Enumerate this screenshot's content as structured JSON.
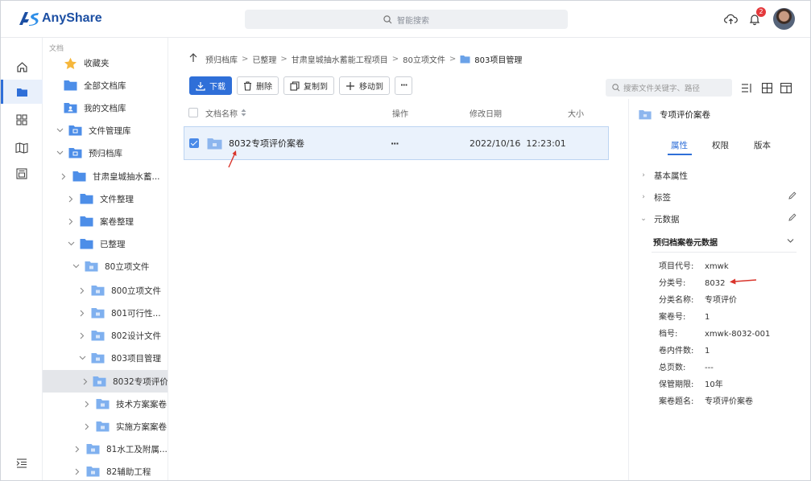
{
  "app": {
    "name": "AnyShare"
  },
  "header": {
    "search_placeholder": "智能搜索",
    "notification_count": "2",
    "colors": {
      "brand": "#1c4fa3",
      "accent": "#2f6fd8",
      "badge": "#e4393c"
    }
  },
  "rail": {
    "items": [
      "home-icon",
      "folder-icon",
      "apps-grid-icon",
      "book-icon",
      "contact-card-icon"
    ],
    "bottom": "collapse-menu-icon"
  },
  "tree": {
    "heading": "文档",
    "items": [
      {
        "label": "收藏夹",
        "icon": "star-icon"
      },
      {
        "label": "全部文档库",
        "icon": "folder-icon"
      },
      {
        "label": "我的文档库",
        "icon": "user-folder-icon"
      },
      {
        "label": "文件管理库",
        "icon": "library-icon",
        "state": "expanded"
      },
      {
        "label": "预归档库",
        "icon": "library-icon",
        "state": "expanded"
      },
      {
        "label": "甘肃皇城抽水蓄...",
        "icon": "folder-icon",
        "state": "collapsed"
      },
      {
        "label": "文件整理",
        "icon": "folder-icon",
        "state": "collapsed"
      },
      {
        "label": "案卷整理",
        "icon": "folder-icon",
        "state": "collapsed"
      },
      {
        "label": "已整理",
        "icon": "folder-icon",
        "state": "expanded"
      },
      {
        "label": "80立项文件",
        "icon": "archive-folder-icon",
        "state": "expanded"
      },
      {
        "label": "800立项文件",
        "icon": "archive-folder-icon",
        "state": "collapsed"
      },
      {
        "label": "801可行性...",
        "icon": "archive-folder-icon",
        "state": "collapsed"
      },
      {
        "label": "802设计文件",
        "icon": "archive-folder-icon",
        "state": "collapsed"
      },
      {
        "label": "803项目管理",
        "icon": "archive-folder-icon",
        "state": "expanded"
      },
      {
        "label": "8032专项评价案",
        "icon": "archive-folder-icon",
        "state": "collapsed",
        "selected": true
      },
      {
        "label": "技术方案案卷",
        "icon": "archive-folder-icon",
        "state": "collapsed"
      },
      {
        "label": "实施方案案卷",
        "icon": "archive-folder-icon",
        "state": "collapsed"
      },
      {
        "label": "81水工及附属...",
        "icon": "archive-folder-icon",
        "state": "collapsed"
      },
      {
        "label": "82辅助工程",
        "icon": "archive-folder-icon",
        "state": "collapsed"
      }
    ]
  },
  "breadcrumb": {
    "items": [
      "预归档库",
      "已整理",
      "甘肃皇城抽水蓄能工程项目",
      "80立项文件",
      "803项目管理"
    ],
    "separator": ">"
  },
  "toolbar": {
    "download": "下载",
    "delete": "删除",
    "copy_to": "复制到",
    "move_to": "移动到",
    "more": "···"
  },
  "right_search": {
    "placeholder": "搜索文件关键字、路径"
  },
  "table": {
    "headers": {
      "name": "文档名称",
      "actions": "操作",
      "modified": "修改日期",
      "size": "大小"
    },
    "rows": [
      {
        "name": "8032专项评价案卷",
        "actions": "···",
        "modified": "2022/10/16  12:23:01",
        "size": "",
        "selected": true
      }
    ]
  },
  "detail": {
    "title": "专项评价案卷",
    "tabs": [
      "属性",
      "权限",
      "版本"
    ],
    "active_tab": "属性",
    "sections": {
      "basic": "基本属性",
      "tags": "标签",
      "metadata": "元数据"
    },
    "metadata_group": "预归档案卷元数据",
    "fields": [
      {
        "key": "项目代号:",
        "value": "xmwk"
      },
      {
        "key": "分类号:",
        "value": "8032"
      },
      {
        "key": "分类名称:",
        "value": "专项评价"
      },
      {
        "key": "案卷号:",
        "value": "1"
      },
      {
        "key": "档号:",
        "value": "xmwk-8032-001"
      },
      {
        "key": "卷内件数:",
        "value": "1"
      },
      {
        "key": "总页数:",
        "value": "---"
      },
      {
        "key": "保管期限:",
        "value": "10年"
      },
      {
        "key": "案卷题名:",
        "value": "专项评价案卷"
      }
    ]
  }
}
